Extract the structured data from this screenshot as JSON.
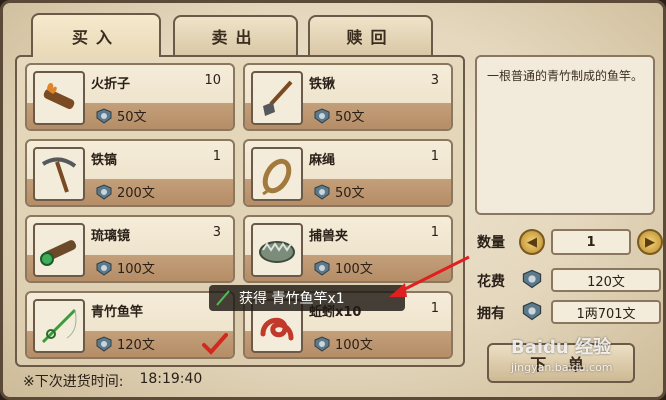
{
  "tabs": [
    {
      "label": "买入",
      "active": true
    },
    {
      "label": "卖出",
      "active": false
    },
    {
      "label": "赎回",
      "active": false
    }
  ],
  "items": [
    {
      "name": "火折子",
      "qty": "10",
      "price": "50文",
      "icon": "fire-torch-icon"
    },
    {
      "name": "铁锹",
      "qty": "3",
      "price": "50文",
      "icon": "shovel-icon"
    },
    {
      "name": "铁镐",
      "qty": "1",
      "price": "200文",
      "icon": "pickaxe-icon"
    },
    {
      "name": "麻绳",
      "qty": "1",
      "price": "50文",
      "icon": "rope-icon"
    },
    {
      "name": "琉璃镜",
      "qty": "3",
      "price": "100文",
      "icon": "spyglass-icon"
    },
    {
      "name": "捕兽夹",
      "qty": "1",
      "price": "100文",
      "icon": "trap-icon"
    },
    {
      "name": "青竹鱼竿",
      "qty": "",
      "price": "120文",
      "icon": "fishing-rod-icon"
    },
    {
      "name": "蚯蚓x10",
      "qty": "1",
      "price": "100文",
      "icon": "worm-icon"
    }
  ],
  "description": "一根普通的青竹制成的鱼竿。",
  "quantity": {
    "label": "数量",
    "value": "1"
  },
  "cost": {
    "label": "花费",
    "value": "120文"
  },
  "owned": {
    "label": "拥有",
    "value": "1两701文"
  },
  "action_button": "下 单",
  "restock": {
    "label": "※下次进货时间:",
    "time": "18:19:40"
  },
  "toast": "获得 青竹鱼竿x1",
  "watermark": {
    "brand": "Baidu 经验",
    "url": "jingyan.baidu.com"
  },
  "colors": {
    "frame": "#5b4a38",
    "price_band": "#b58d67",
    "coin": "#5e7a8a",
    "arrow": "#e02020"
  }
}
